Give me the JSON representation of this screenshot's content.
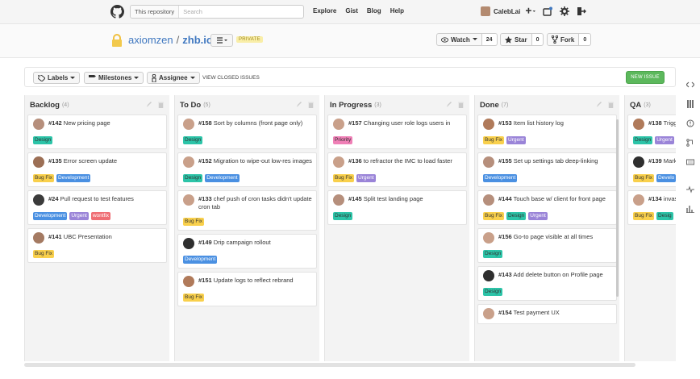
{
  "header": {
    "search_scope": "This repository",
    "search_placeholder": "Search",
    "nav": [
      "Explore",
      "Gist",
      "Blog",
      "Help"
    ],
    "username": "CalebLai"
  },
  "repo": {
    "owner": "axiomzen",
    "separator": "/",
    "name": "zhb.io",
    "privacy": "PRIVATE",
    "watch_label": "Watch",
    "watch_count": "24",
    "star_label": "Star",
    "star_count": "0",
    "fork_label": "Fork",
    "fork_count": "0"
  },
  "toolbar": {
    "labels": "Labels",
    "milestones": "Milestones",
    "assignee": "Assignee",
    "view_closed": "VIEW CLOSED ISSUES",
    "new_issue": "NEW ISSUE"
  },
  "label_colors": {
    "Design": "#2cc4a8",
    "Bug Fix": "#f9d04c",
    "Development": "#4a90e2",
    "Urgent": "#9a84d8",
    "wontfix": "#ef6e74",
    "Priority": "#ef7fb6"
  },
  "columns": [
    {
      "name": "Backlog",
      "count": "(4)",
      "cards": [
        {
          "num": "#142",
          "title": "New pricing page",
          "labels": [
            "Design"
          ],
          "avatar": "#b68f7c"
        },
        {
          "num": "#135",
          "title": "Error screen update",
          "labels": [
            "Bug Fix",
            "Development"
          ],
          "avatar": "#9c6f55"
        },
        {
          "num": "#24",
          "title": "Pull request to test features",
          "labels": [
            "Development",
            "Urgent",
            "wontfix"
          ],
          "avatar": "#3b3b3b"
        },
        {
          "num": "#141",
          "title": "UBC Presentation",
          "labels": [
            "Bug Fix"
          ],
          "avatar": "#a47a62"
        }
      ]
    },
    {
      "name": "To Do",
      "count": "(5)",
      "cards": [
        {
          "num": "#158",
          "title": "Sort by columns (front page only)",
          "labels": [
            "Design"
          ],
          "avatar": "#c9a08a"
        },
        {
          "num": "#152",
          "title": "Migration to wipe-out low-res images",
          "labels": [
            "Design",
            "Development"
          ],
          "avatar": "#c9a08a"
        },
        {
          "num": "#133",
          "title": "chef push of cron tasks didn't update cron tab",
          "labels": [
            "Bug Fix"
          ],
          "avatar": "#c9a08a"
        },
        {
          "num": "#149",
          "title": "Drip campaign rollout",
          "labels": [
            "Development"
          ],
          "avatar": "#2f2f2f"
        },
        {
          "num": "#151",
          "title": "Update logs to reflect rebrand",
          "labels": [
            "Bug Fix"
          ],
          "avatar": "#b07a5a"
        }
      ]
    },
    {
      "name": "In Progress",
      "count": "(3)",
      "cards": [
        {
          "num": "#157",
          "title": "Changing user role logs users in",
          "labels": [
            "Priority"
          ],
          "avatar": "#c9a08a"
        },
        {
          "num": "#136",
          "title": "to refractor the IMC to load faster",
          "labels": [
            "Bug Fix",
            "Urgent"
          ],
          "avatar": "#c9a08a"
        },
        {
          "num": "#145",
          "title": "Split test landing page",
          "labels": [
            "Design"
          ],
          "avatar": "#b68f7c"
        }
      ]
    },
    {
      "name": "Done",
      "count": "(7)",
      "cards": [
        {
          "num": "#153",
          "title": "Item list history log",
          "labels": [
            "Bug Fix",
            "Urgent"
          ],
          "avatar": "#b07a5a"
        },
        {
          "num": "#155",
          "title": "Set up settings tab deep-linking",
          "labels": [
            "Development"
          ],
          "avatar": "#b68f7c"
        },
        {
          "num": "#144",
          "title": "Touch base w/ client for front page",
          "labels": [
            "Bug Fix",
            "Design",
            "Urgent"
          ],
          "avatar": "#b68f7c"
        },
        {
          "num": "#156",
          "title": "Go-to page visible at all times",
          "labels": [
            "Design"
          ],
          "avatar": "#c9a08a"
        },
        {
          "num": "#143",
          "title": "Add delete button on Profile page",
          "labels": [
            "Design"
          ],
          "avatar": "#2f2f2f"
        },
        {
          "num": "#154",
          "title": "Test payment UX",
          "labels": [],
          "avatar": "#c9a08a"
        }
      ]
    },
    {
      "name": "QA",
      "count": "(3)",
      "cards": [
        {
          "num": "#138",
          "title": "Trigg",
          "labels": [
            "Design",
            "Urgent"
          ],
          "avatar": "#b07a5a"
        },
        {
          "num": "#139",
          "title": "Mark emphasis",
          "labels": [
            "Bug Fix",
            "Develo"
          ],
          "avatar": "#2f2f2f"
        },
        {
          "num": "#134",
          "title": "invas always be",
          "labels": [
            "Bug Fix",
            "Desig"
          ],
          "avatar": "#c9a08a"
        }
      ]
    }
  ]
}
